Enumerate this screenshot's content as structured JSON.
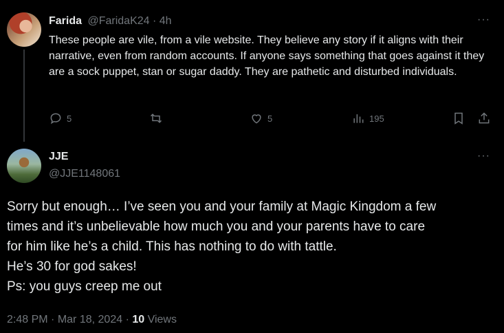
{
  "reply": {
    "name": "Farida",
    "handle": "@FaridaK24",
    "separator": "·",
    "time": "4h",
    "text": "These people are vile, from a vile website. They believe any story if it aligns with their narrative, even from random accounts. If anyone says something that goes against it they are a sock puppet, stan or sugar daddy. They are pathetic and disturbed individuals.",
    "more": "···",
    "actions": {
      "replies": "5",
      "likes": "5",
      "views": "195"
    },
    "icons": [
      "reply-icon",
      "retweet-icon",
      "like-icon",
      "views-icon",
      "bookmark-icon",
      "share-icon"
    ]
  },
  "main": {
    "name": "JJE",
    "handle": "@JJE1148061",
    "more": "···",
    "lines": [
      "Sorry but enough… I’ve seen you and your family at Magic Kingdom a few",
      "times and it’s unbelievable how much you and your parents have to care",
      "for him like he’s a child. This has nothing to do with tattle.",
      "He’s 30 for god sakes!",
      "Ps: you guys creep me out"
    ],
    "time": "2:48 PM",
    "separator": "·",
    "date": "Mar 18, 2024",
    "views_count": "10",
    "views_label": "Views"
  },
  "colors": {
    "background": "#000000",
    "text": "#e7e9ea",
    "muted": "#71767b",
    "thread_line": "#333639"
  }
}
